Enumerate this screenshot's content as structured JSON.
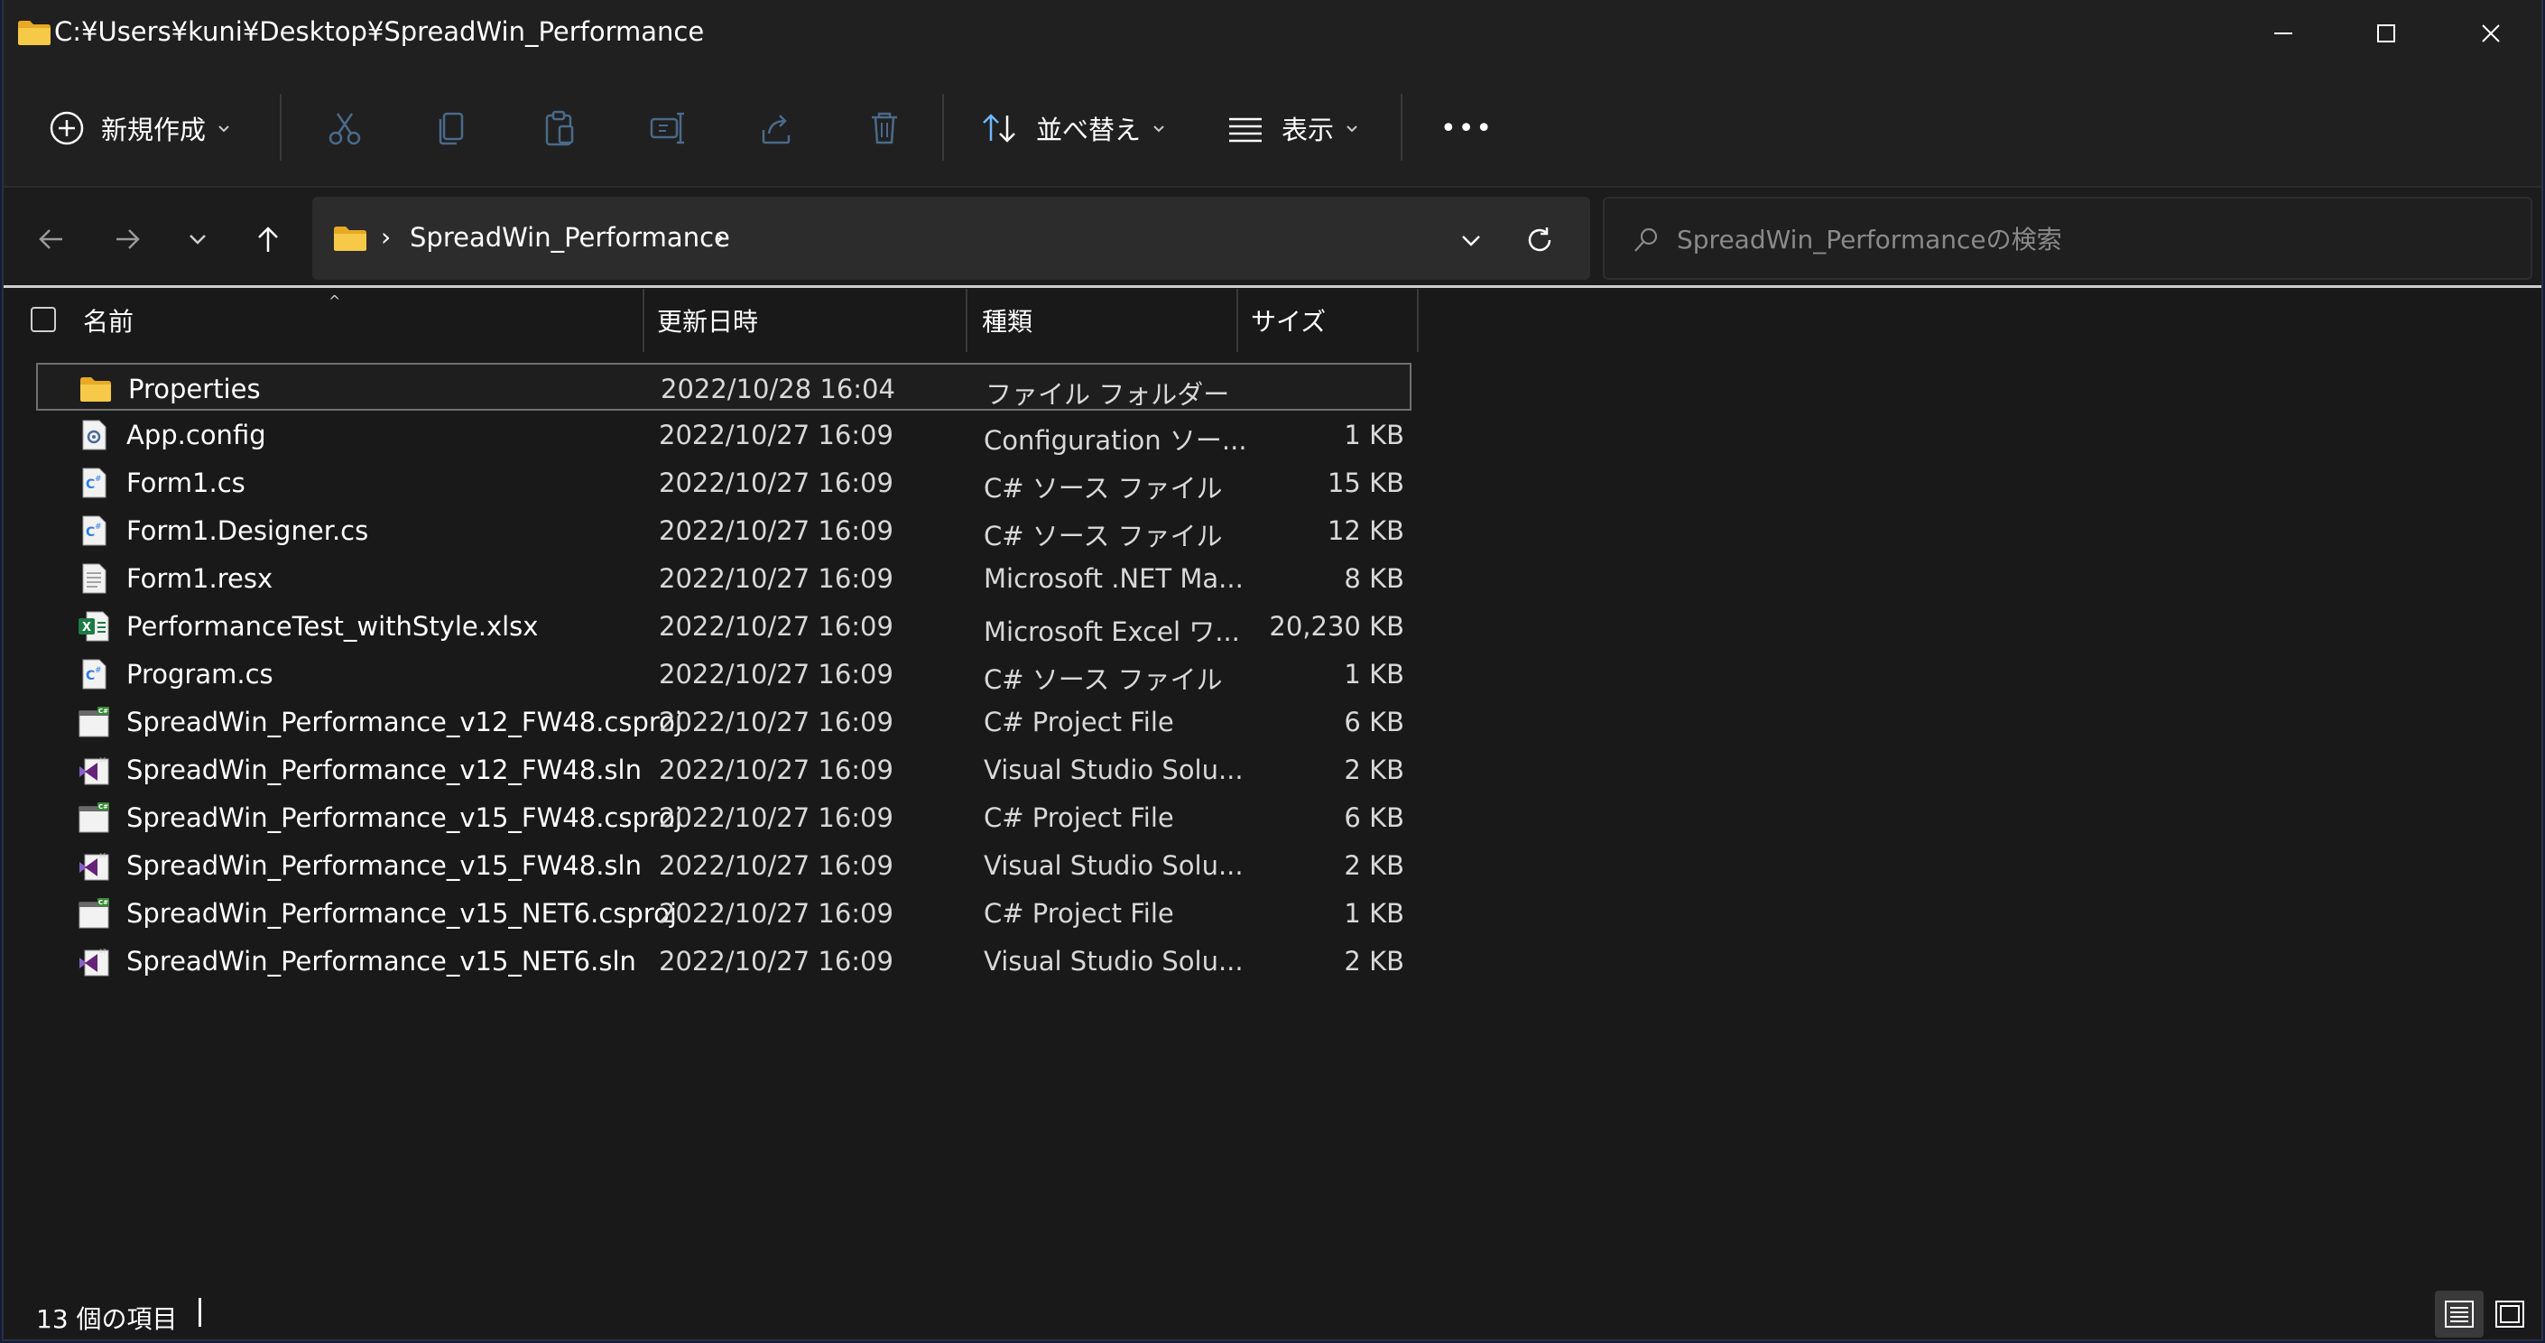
{
  "window": {
    "title": "C:¥Users¥kuni¥Desktop¥SpreadWin_Performance"
  },
  "toolbar": {
    "new_label": "新規作成",
    "sort_label": "並べ替え",
    "view_label": "表示",
    "more_label": "•••"
  },
  "address": {
    "path_segment": "SpreadWin_Performance"
  },
  "search": {
    "placeholder": "SpreadWin_Performanceの検索"
  },
  "columns": {
    "name": "名前",
    "date": "更新日時",
    "type": "種類",
    "size": "サイズ"
  },
  "files": [
    {
      "name": "Properties",
      "date": "2022/10/28 16:04",
      "type": "ファイル フォルダー",
      "size": "",
      "icon": "folder-icon"
    },
    {
      "name": "App.config",
      "date": "2022/10/27 16:09",
      "type": "Configuration ソー...",
      "size": "1 KB",
      "icon": "config-file-icon"
    },
    {
      "name": "Form1.cs",
      "date": "2022/10/27 16:09",
      "type": "C# ソース ファイル",
      "size": "15 KB",
      "icon": "csharp-file-icon"
    },
    {
      "name": "Form1.Designer.cs",
      "date": "2022/10/27 16:09",
      "type": "C# ソース ファイル",
      "size": "12 KB",
      "icon": "csharp-file-icon"
    },
    {
      "name": "Form1.resx",
      "date": "2022/10/27 16:09",
      "type": "Microsoft .NET Ma...",
      "size": "8 KB",
      "icon": "resx-file-icon"
    },
    {
      "name": "PerformanceTest_withStyle.xlsx",
      "date": "2022/10/27 16:09",
      "type": "Microsoft Excel ワ...",
      "size": "20,230 KB",
      "icon": "excel-file-icon"
    },
    {
      "name": "Program.cs",
      "date": "2022/10/27 16:09",
      "type": "C# ソース ファイル",
      "size": "1 KB",
      "icon": "csharp-file-icon"
    },
    {
      "name": "SpreadWin_Performance_v12_FW48.csproj",
      "date": "2022/10/27 16:09",
      "type": "C# Project File",
      "size": "6 KB",
      "icon": "csproj-file-icon"
    },
    {
      "name": "SpreadWin_Performance_v12_FW48.sln",
      "date": "2022/10/27 16:09",
      "type": "Visual Studio Solu...",
      "size": "2 KB",
      "icon": "vs-solution-icon"
    },
    {
      "name": "SpreadWin_Performance_v15_FW48.csproj",
      "date": "2022/10/27 16:09",
      "type": "C# Project File",
      "size": "6 KB",
      "icon": "csproj-file-icon"
    },
    {
      "name": "SpreadWin_Performance_v15_FW48.sln",
      "date": "2022/10/27 16:09",
      "type": "Visual Studio Solu...",
      "size": "2 KB",
      "icon": "vs-solution-icon"
    },
    {
      "name": "SpreadWin_Performance_v15_NET6.csproj",
      "date": "2022/10/27 16:09",
      "type": "C# Project File",
      "size": "1 KB",
      "icon": "csproj-file-icon"
    },
    {
      "name": "SpreadWin_Performance_v15_NET6.sln",
      "date": "2022/10/27 16:09",
      "type": "Visual Studio Solu...",
      "size": "2 KB",
      "icon": "vs-solution-icon"
    }
  ],
  "status": {
    "item_count": "13 個の項目"
  },
  "colors": {
    "folder": "#f5c542",
    "accent_blue": "#4aa3ff",
    "vs_purple": "#8661c5",
    "excel_green": "#21a366"
  }
}
